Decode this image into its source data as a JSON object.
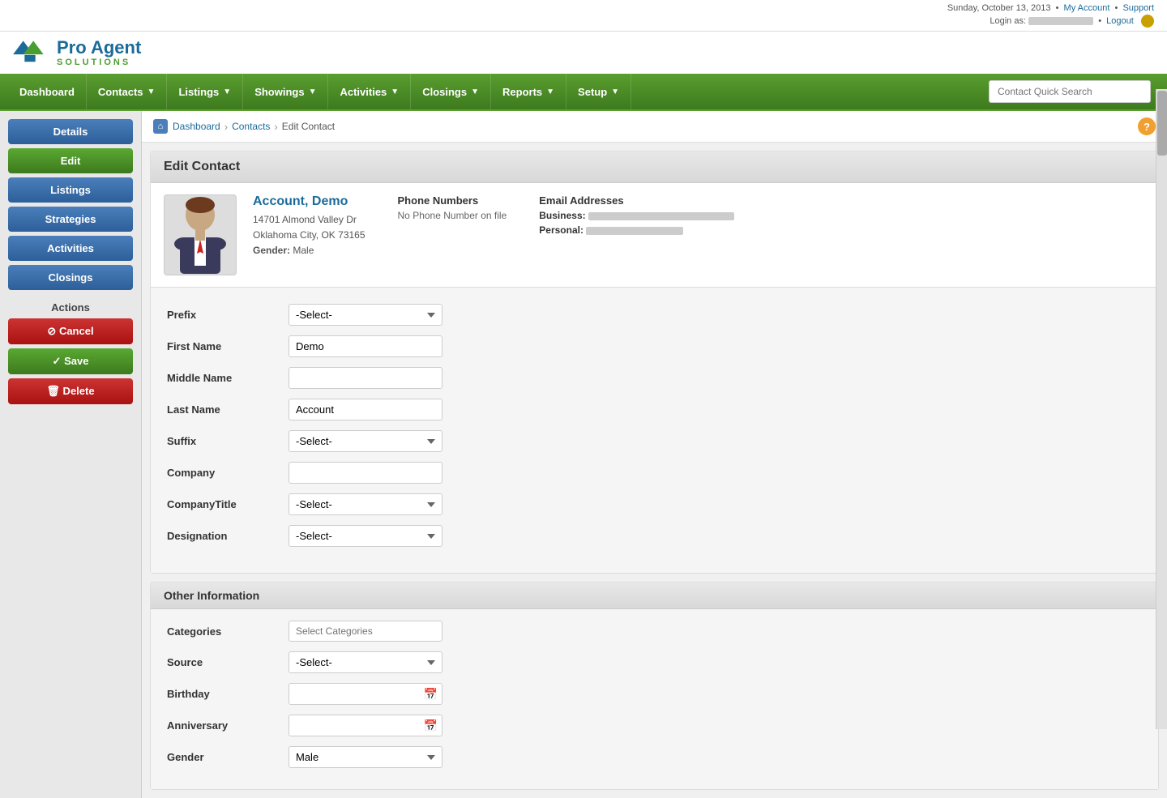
{
  "app": {
    "name": "Pro Agent Solutions",
    "logo_line1": "Pro Agent",
    "logo_line2": "SOLUTIONS"
  },
  "topbar": {
    "date": "Sunday, October 13, 2013",
    "my_account": "My Account",
    "support": "Support",
    "login_label": "Login as:",
    "login_user": "████████",
    "logout": "Logout"
  },
  "nav": {
    "items": [
      {
        "label": "Dashboard",
        "has_dropdown": false
      },
      {
        "label": "Contacts",
        "has_dropdown": true
      },
      {
        "label": "Listings",
        "has_dropdown": true
      },
      {
        "label": "Showings",
        "has_dropdown": true
      },
      {
        "label": "Activities",
        "has_dropdown": true
      },
      {
        "label": "Closings",
        "has_dropdown": true
      },
      {
        "label": "Reports",
        "has_dropdown": true
      },
      {
        "label": "Setup",
        "has_dropdown": true
      }
    ],
    "search_placeholder": "Contact Quick Search"
  },
  "breadcrumb": {
    "home_icon": "⌂",
    "items": [
      "Dashboard",
      "Contacts",
      "Edit Contact"
    ]
  },
  "sidebar": {
    "nav_buttons": [
      {
        "label": "Details",
        "style": "blue"
      },
      {
        "label": "Edit",
        "style": "green"
      },
      {
        "label": "Listings",
        "style": "blue"
      },
      {
        "label": "Strategies",
        "style": "blue"
      },
      {
        "label": "Activities",
        "style": "blue"
      },
      {
        "label": "Closings",
        "style": "blue"
      }
    ],
    "actions_title": "Actions",
    "action_buttons": [
      {
        "label": "✕  Cancel",
        "style": "red"
      },
      {
        "label": "✓  Save",
        "style": "green"
      },
      {
        "label": "🗑  Delete",
        "style": "red"
      }
    ]
  },
  "page_title": "Edit Contact",
  "contact": {
    "name": "Account, Demo",
    "address_line1": "14701 Almond Valley Dr",
    "address_line2": "Oklahoma City, OK 73165",
    "gender_label": "Gender:",
    "gender": "Male",
    "phone_title": "Phone Numbers",
    "phone_value": "No Phone Number on file",
    "email_title": "Email Addresses",
    "business_label": "Business:",
    "personal_label": "Personal:"
  },
  "form": {
    "fields": [
      {
        "label": "Prefix",
        "type": "select",
        "value": "-Select-"
      },
      {
        "label": "First Name",
        "type": "text",
        "value": "Demo"
      },
      {
        "label": "Middle Name",
        "type": "text",
        "value": ""
      },
      {
        "label": "Last Name",
        "type": "text",
        "value": "Account"
      },
      {
        "label": "Suffix",
        "type": "select",
        "value": "-Select-"
      },
      {
        "label": "Company",
        "type": "text",
        "value": ""
      },
      {
        "label": "CompanyTitle",
        "type": "select",
        "value": "-Select-"
      },
      {
        "label": "Designation",
        "type": "select",
        "value": "-Select-"
      }
    ]
  },
  "other_info": {
    "title": "Other Information",
    "fields": [
      {
        "label": "Categories",
        "type": "placeholder",
        "placeholder": "Select Categories"
      },
      {
        "label": "Source",
        "type": "select",
        "value": "-Select-"
      },
      {
        "label": "Birthday",
        "type": "date",
        "value": ""
      },
      {
        "label": "Anniversary",
        "type": "date",
        "value": ""
      },
      {
        "label": "Gender",
        "type": "select",
        "value": "Male"
      }
    ]
  }
}
